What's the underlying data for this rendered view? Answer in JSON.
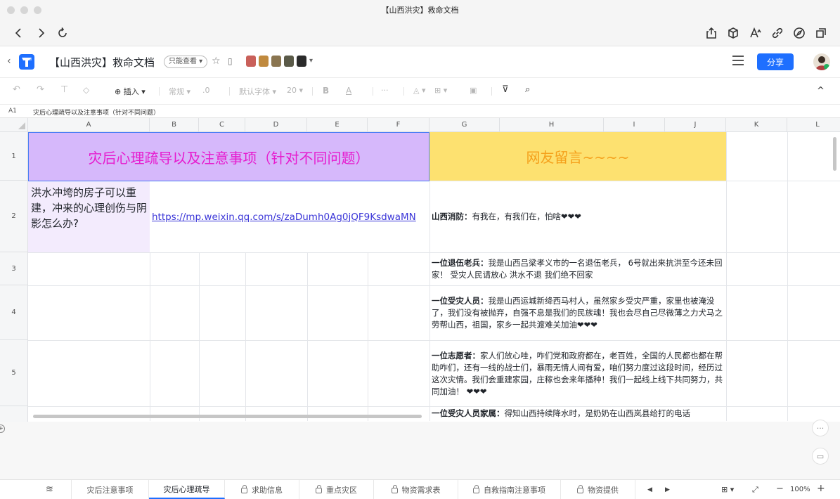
{
  "window": {
    "title": "【山西洪灾】救命文档"
  },
  "nav": {
    "back": "back-icon",
    "forward": "forward-icon",
    "reload": "reload-icon"
  },
  "header": {
    "back_glyph": "‹",
    "doc_title": "【山西洪灾】救命文档",
    "permission": "只能查看 ▾",
    "share_label": "分享",
    "avatars_more": "▾"
  },
  "toolbar": {
    "insert_label": "⊕ 插入 ▾",
    "format_label": "常规 ▾",
    "decimals": ".0",
    "font_label": "默认字体 ▾",
    "size_label": "20 ▾",
    "bold": "B",
    "text_color": "A",
    "more": "···",
    "collapse": "^"
  },
  "formula": {
    "cell_ref": "A1",
    "content": "灾后心理疏导以及注意事项（针对不同问题）"
  },
  "columns": [
    "A",
    "B",
    "C",
    "D",
    "E",
    "F",
    "G",
    "H",
    "I",
    "J",
    "K",
    "L"
  ],
  "rows": [
    "1",
    "2",
    "3",
    "4",
    "5"
  ],
  "cells": {
    "a1": "灾后心理疏导以及注意事项（针对不同问题）",
    "g1": "网友留言~~~~",
    "a2": "洪水冲垮的房子可以重建，冲来的心理创伤与阴影怎么办?",
    "b2": "https://mp.weixin.qq.com/s/zaDumh0Ag0jQF9KsdwaMN",
    "g2_author": "山西消防：",
    "g2_text": "有我在，有我们在，怕啥❤❤❤",
    "g3_author": "一位退伍老兵：",
    "g3_text": "我是山西吕梁孝义市的一名退伍老兵， 6号就出来抗洪至今还未回家！ 受灾人民请放心 洪水不退 我们绝不回家",
    "g4_author": "一位受灾人员：",
    "g4_text": "我是山西运城新绛西马村人，虽然家乡受灾严重，家里也被淹没了，我们没有被抛弃，自强不息是我们的民族魂！我也会尽自己尽微薄之力犬马之劳帮山西，祖国，家乡一起共渡难关加油❤❤❤",
    "g5_author": "一位志愿者：",
    "g5_text": "家人们放心哇，咋们党和政府都在，老百姓，全国的人民都也都在帮助咋们，还有一线的战士们，暴雨无情人间有爱，咱们努力度过这段时间，经历过这次灾情。我们会重建家园，庄稼也会来年播种！我们一起线上线下共同努力，共同加油！ ❤❤❤",
    "g6_author": "一位受灾人员家属：",
    "g6_text": "得知山西持续降水时，是奶奶在山西岚县给打的电话"
  },
  "sheet_tabs": [
    {
      "label": "灾后注意事项",
      "locked": false
    },
    {
      "label": "灾后心理疏导",
      "locked": false
    },
    {
      "label": "求助信息",
      "locked": true
    },
    {
      "label": "重点灾区",
      "locked": true
    },
    {
      "label": "物资需求表",
      "locked": true
    },
    {
      "label": "自救指南注意事项",
      "locked": true
    },
    {
      "label": "物资提供",
      "locked": true
    }
  ],
  "zoom": {
    "minus": "−",
    "value": "100%",
    "plus": "+"
  },
  "colors": {
    "accent": "#1e6fff",
    "header_purple": "#d6b8fb",
    "header_yellow": "#fde170",
    "title_magenta": "#e61ccf",
    "title_orange": "#f5a11c"
  }
}
